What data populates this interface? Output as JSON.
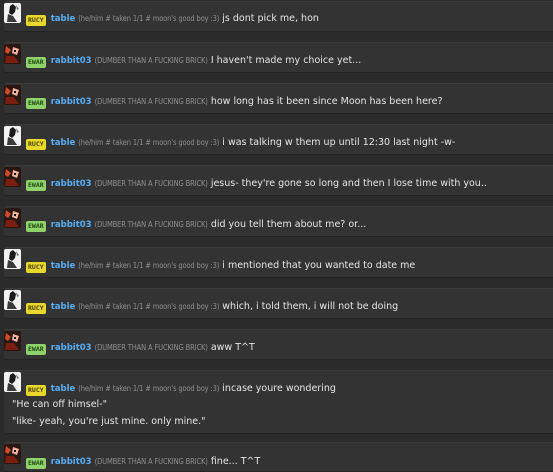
{
  "messages": [
    {
      "user": "table",
      "badge": "RUCY",
      "bio": "(he/him # taken 1/1 # moon's good boy :3)",
      "text": "js dont pick me, hon",
      "avatar": "table"
    },
    {
      "user": "rabbit03",
      "badge": "EWAR",
      "bio": "(DUMBER THAN A FUCKING BRICK)",
      "text": "I haven't made my choice yet...",
      "avatar": "rabbit"
    },
    {
      "user": "rabbit03",
      "badge": "EWAR",
      "bio": "(DUMBER THAN A FUCKING BRICK)",
      "text": "how long has it been since Moon has been here?",
      "avatar": "rabbit"
    },
    {
      "user": "table",
      "badge": "RUCY",
      "bio": "(he/him # taken 1/1 # moon's good boy :3)",
      "text": "i was talking w them up until 12:30 last night -w-",
      "avatar": "table"
    },
    {
      "user": "rabbit03",
      "badge": "EWAR",
      "bio": "(DUMBER THAN A FUCKING BRICK)",
      "text": "jesus- they're gone so long and then I lose time with you..",
      "avatar": "rabbit"
    },
    {
      "user": "rabbit03",
      "badge": "EWAR",
      "bio": "(DUMBER THAN A FUCKING BRICK)",
      "text": "did you tell them about me? or...",
      "avatar": "rabbit"
    },
    {
      "user": "table",
      "badge": "RUCY",
      "bio": "(he/him # taken 1/1 # moon's good boy :3)",
      "text": "i mentioned that you wanted to date me",
      "avatar": "table"
    },
    {
      "user": "table",
      "badge": "RUCY",
      "bio": "(he/him # taken 1/1 # moon's good boy :3)",
      "text": "which, i told them, i will not be doing",
      "avatar": "table"
    },
    {
      "user": "rabbit03",
      "badge": "EWAR",
      "bio": "(DUMBER THAN A FUCKING BRICK)",
      "text": "aww T^T",
      "avatar": "rabbit"
    },
    {
      "user": "table",
      "badge": "RUCY",
      "bio": "(he/him # taken 1/1 # moon's good boy :3)",
      "text": "incase youre wondering",
      "avatar": "table",
      "extra_lines": [
        "\"He can off himsel-\"",
        "\"like- yeah, you're just mine. only mine.\""
      ]
    },
    {
      "user": "rabbit03",
      "badge": "EWAR",
      "bio": "(DUMBER THAN A FUCKING BRICK)",
      "text": "fine... T^T",
      "avatar": "rabbit"
    }
  ],
  "colors": {
    "username": "#58aef5",
    "rucy_badge": "#e8d82a",
    "ewar_badge": "#8fd16a",
    "background": "#2b2b2b",
    "message_bg": "#333333"
  }
}
